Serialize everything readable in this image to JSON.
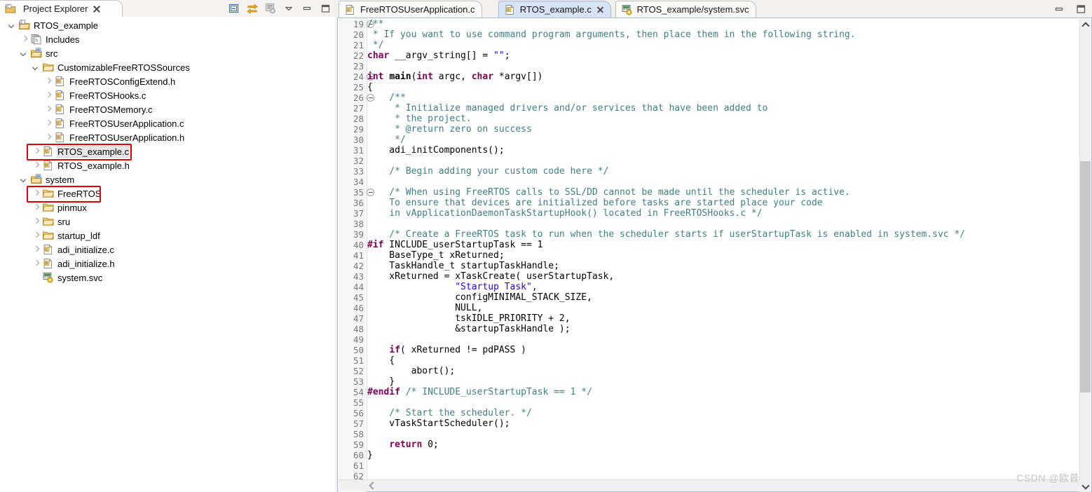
{
  "explorer": {
    "tab_label": "Project Explorer",
    "toolbar_icons": [
      "collapse-all-icon",
      "link-with-editor-icon",
      "view-menu-filter-icon",
      "view-menu-icon",
      "minimize-icon",
      "maximize-icon"
    ],
    "tree": [
      {
        "label": "RTOS_example",
        "icon": "project-icon",
        "indent": 0,
        "arrow": "expanded"
      },
      {
        "label": "Includes",
        "icon": "includes-icon",
        "indent": 1,
        "arrow": "collapsed"
      },
      {
        "label": "src",
        "icon": "source-folder-icon",
        "indent": 1,
        "arrow": "expanded"
      },
      {
        "label": "CustomizableFreeRTOSSources",
        "icon": "folder-icon",
        "indent": 2,
        "arrow": "expanded"
      },
      {
        "label": "FreeRTOSConfigExtend.h",
        "icon": "h-file-icon",
        "indent": 3,
        "arrow": "collapsed"
      },
      {
        "label": "FreeRTOSHooks.c",
        "icon": "c-file-icon",
        "indent": 3,
        "arrow": "collapsed"
      },
      {
        "label": "FreeRTOSMemory.c",
        "icon": "c-file-icon",
        "indent": 3,
        "arrow": "collapsed"
      },
      {
        "label": "FreeRTOSUserApplication.c",
        "icon": "c-file-icon",
        "indent": 3,
        "arrow": "collapsed"
      },
      {
        "label": "FreeRTOSUserApplication.h",
        "icon": "h-file-icon",
        "indent": 3,
        "arrow": "collapsed"
      },
      {
        "label": "RTOS_example.c",
        "icon": "c-file-icon",
        "indent": 2,
        "arrow": "collapsed",
        "selected": true,
        "highlight": true
      },
      {
        "label": "RTOS_example.h",
        "icon": "h-file-icon",
        "indent": 2,
        "arrow": "collapsed"
      },
      {
        "label": "system",
        "icon": "source-folder-icon",
        "indent": 1,
        "arrow": "expanded"
      },
      {
        "label": "FreeRTOS",
        "icon": "folder-icon",
        "indent": 2,
        "arrow": "collapsed",
        "highlight": true
      },
      {
        "label": "pinmux",
        "icon": "folder-icon",
        "indent": 2,
        "arrow": "collapsed"
      },
      {
        "label": "sru",
        "icon": "folder-icon",
        "indent": 2,
        "arrow": "collapsed"
      },
      {
        "label": "startup_ldf",
        "icon": "folder-icon",
        "indent": 2,
        "arrow": "collapsed"
      },
      {
        "label": "adi_initialize.c",
        "icon": "c-file-icon",
        "indent": 2,
        "arrow": "collapsed"
      },
      {
        "label": "adi_initialize.h",
        "icon": "h-file-icon",
        "indent": 2,
        "arrow": "collapsed"
      },
      {
        "label": "system.svc",
        "icon": "svc-file-icon",
        "indent": 2,
        "arrow": "none"
      }
    ]
  },
  "editor": {
    "tabs": [
      {
        "label": "FreeRTOSUserApplication.c",
        "icon": "c-file-icon",
        "active": false,
        "closable": false
      },
      {
        "label": "RTOS_example.c",
        "icon": "c-file-icon",
        "active": true,
        "closable": true
      },
      {
        "label": "RTOS_example/system.svc",
        "icon": "svc-file-icon",
        "active": false,
        "closable": false
      }
    ],
    "window_controls": [
      "minimize-icon",
      "maximize-icon"
    ],
    "first_line_number": 19,
    "last_line_number": 62,
    "fold_lines": [
      19,
      24,
      26,
      35
    ],
    "lines": [
      {
        "n": 19,
        "tokens": [
          {
            "t": "/**",
            "c": "cmt"
          }
        ]
      },
      {
        "n": 20,
        "tokens": [
          {
            "t": " * If you want to use command program arguments, then place them in the following string.",
            "c": "cmt"
          }
        ]
      },
      {
        "n": 21,
        "tokens": [
          {
            "t": " */",
            "c": "cmt"
          }
        ]
      },
      {
        "n": 22,
        "tokens": [
          {
            "t": "char",
            "c": "kw"
          },
          {
            "t": " __argv_string[] = ",
            "c": "fn"
          },
          {
            "t": "\"\"",
            "c": "str"
          },
          {
            "t": ";",
            "c": "fn"
          }
        ]
      },
      {
        "n": 23,
        "tokens": []
      },
      {
        "n": 24,
        "tokens": [
          {
            "t": "int",
            "c": "kw"
          },
          {
            "t": " ",
            "c": "fn"
          },
          {
            "t": "main",
            "c": "bold"
          },
          {
            "t": "(",
            "c": "fn"
          },
          {
            "t": "int",
            "c": "kw"
          },
          {
            "t": " argc, ",
            "c": "fn"
          },
          {
            "t": "char",
            "c": "kw"
          },
          {
            "t": " *argv[])",
            "c": "fn"
          }
        ]
      },
      {
        "n": 25,
        "tokens": [
          {
            "t": "{",
            "c": "fn"
          }
        ]
      },
      {
        "n": 26,
        "tokens": [
          {
            "t": "    /**",
            "c": "cmt"
          }
        ]
      },
      {
        "n": 27,
        "tokens": [
          {
            "t": "     * Initialize managed drivers and/or services that have been added to",
            "c": "cmt"
          }
        ]
      },
      {
        "n": 28,
        "tokens": [
          {
            "t": "     * the project.",
            "c": "cmt"
          }
        ]
      },
      {
        "n": 29,
        "tokens": [
          {
            "t": "     * @return zero on success",
            "c": "cmt"
          }
        ]
      },
      {
        "n": 30,
        "tokens": [
          {
            "t": "     */",
            "c": "cmt"
          }
        ]
      },
      {
        "n": 31,
        "tokens": [
          {
            "t": "    adi_initComponents();",
            "c": "fn"
          }
        ]
      },
      {
        "n": 32,
        "tokens": []
      },
      {
        "n": 33,
        "tokens": [
          {
            "t": "    /* Begin adding your custom code here */",
            "c": "cmt"
          }
        ]
      },
      {
        "n": 34,
        "tokens": []
      },
      {
        "n": 35,
        "tokens": [
          {
            "t": "    /* When using FreeRTOS calls to SSL/DD cannot be made until the scheduler is active.",
            "c": "cmt"
          }
        ]
      },
      {
        "n": 36,
        "tokens": [
          {
            "t": "    To ensure that devices are initialized before tasks are started place your code",
            "c": "cmt"
          }
        ]
      },
      {
        "n": 37,
        "tokens": [
          {
            "t": "    in vApplicationDaemonTaskStartupHook() located in FreeRTOSHooks.c */",
            "c": "cmt"
          }
        ]
      },
      {
        "n": 38,
        "tokens": []
      },
      {
        "n": 39,
        "tokens": [
          {
            "t": "    /* Create a FreeRTOS task to run when the scheduler starts if userStartupTask is enabled in system.svc */",
            "c": "cmt"
          }
        ]
      },
      {
        "n": 40,
        "tokens": [
          {
            "t": "#if",
            "c": "pre"
          },
          {
            "t": " INCLUDE_userStartupTask == 1",
            "c": "fn"
          }
        ]
      },
      {
        "n": 41,
        "tokens": [
          {
            "t": "    BaseType_t xReturned;",
            "c": "fn"
          }
        ]
      },
      {
        "n": 42,
        "tokens": [
          {
            "t": "    TaskHandle_t startupTaskHandle;",
            "c": "fn"
          }
        ]
      },
      {
        "n": 43,
        "tokens": [
          {
            "t": "    xReturned = xTaskCreate( userStartupTask,",
            "c": "fn"
          }
        ]
      },
      {
        "n": 44,
        "tokens": [
          {
            "t": "                ",
            "c": "fn"
          },
          {
            "t": "\"Startup Task\"",
            "c": "str"
          },
          {
            "t": ",",
            "c": "fn"
          }
        ]
      },
      {
        "n": 45,
        "tokens": [
          {
            "t": "                configMINIMAL_STACK_SIZE,",
            "c": "fn"
          }
        ]
      },
      {
        "n": 46,
        "tokens": [
          {
            "t": "                NULL,",
            "c": "fn"
          }
        ]
      },
      {
        "n": 47,
        "tokens": [
          {
            "t": "                tskIDLE_PRIORITY + 2,",
            "c": "fn"
          }
        ]
      },
      {
        "n": 48,
        "tokens": [
          {
            "t": "                &startupTaskHandle );",
            "c": "fn"
          }
        ]
      },
      {
        "n": 49,
        "tokens": []
      },
      {
        "n": 50,
        "tokens": [
          {
            "t": "    ",
            "c": "fn"
          },
          {
            "t": "if",
            "c": "kw"
          },
          {
            "t": "( xReturned != pdPASS )",
            "c": "fn"
          }
        ]
      },
      {
        "n": 51,
        "tokens": [
          {
            "t": "    {",
            "c": "fn"
          }
        ]
      },
      {
        "n": 52,
        "tokens": [
          {
            "t": "        abort();",
            "c": "fn"
          }
        ]
      },
      {
        "n": 53,
        "tokens": [
          {
            "t": "    }",
            "c": "fn"
          }
        ]
      },
      {
        "n": 54,
        "tokens": [
          {
            "t": "#endif",
            "c": "pre"
          },
          {
            "t": " /* INCLUDE_userStartupTask == 1 */",
            "c": "cmt"
          }
        ]
      },
      {
        "n": 55,
        "tokens": []
      },
      {
        "n": 56,
        "tokens": [
          {
            "t": "    /* Start the scheduler. */",
            "c": "cmt"
          }
        ]
      },
      {
        "n": 57,
        "tokens": [
          {
            "t": "    vTaskStartScheduler();",
            "c": "fn"
          }
        ]
      },
      {
        "n": 58,
        "tokens": []
      },
      {
        "n": 59,
        "tokens": [
          {
            "t": "    ",
            "c": "fn"
          },
          {
            "t": "return",
            "c": "kw"
          },
          {
            "t": " 0;",
            "c": "fn"
          }
        ]
      },
      {
        "n": 60,
        "tokens": [
          {
            "t": "}",
            "c": "fn"
          }
        ]
      },
      {
        "n": 61,
        "tokens": []
      },
      {
        "n": 62,
        "tokens": []
      }
    ]
  },
  "watermark": {
    "text": "CSDN @欧普"
  },
  "colors": {
    "comment": "#3f7f7f",
    "keyword": "#7f0055",
    "string": "#2a00ff",
    "active_tab_bg": "#d7e4f5",
    "highlight_box": "#e00000",
    "selection_bg": "#e8e8e8"
  }
}
